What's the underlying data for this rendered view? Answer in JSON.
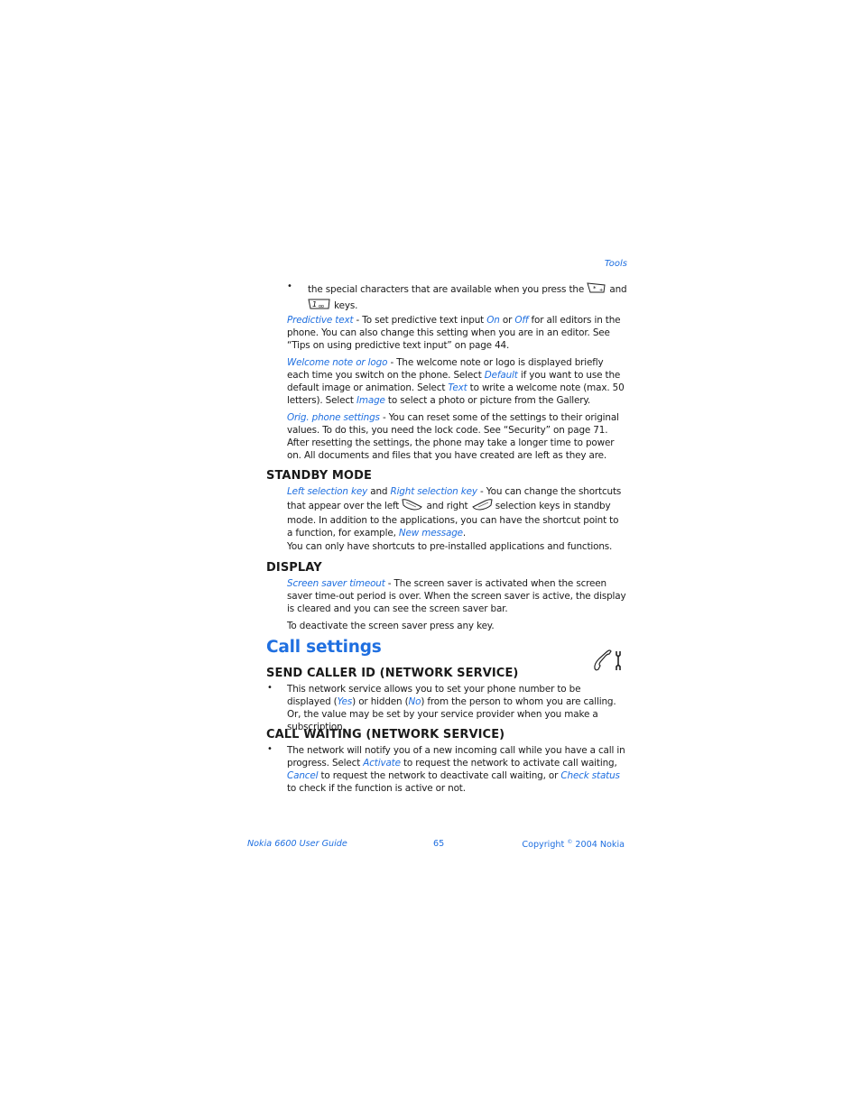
{
  "running_head": "Tools",
  "intro_bullet": {
    "text_before": "the special characters that are available when you press the",
    "and": "and",
    "keys": "keys.",
    "icons": [
      "star-key-icon",
      "one-key-icon"
    ]
  },
  "predictive_text": {
    "term": "Predictive text",
    "t1": " - To set predictive text input ",
    "on": "On",
    "or": " or ",
    "off": "Off",
    "t2": " for all editors in the phone. You can also change this setting when you are in an editor. See “Tips on using predictive text input” on page 44."
  },
  "welcome_note": {
    "term": "Welcome note or logo",
    "t1": " - The welcome note or logo is displayed briefly each time you switch on the phone. Select ",
    "default": "Default",
    "t2": " if you want to use the default image or animation. Select ",
    "text": "Text",
    "t3": " to write a welcome note (max. 50 letters). Select ",
    "image": "Image",
    "t4": " to select a photo or picture from the Gallery."
  },
  "orig_settings": {
    "term": "Orig. phone settings",
    "t1": " - You can reset some of the settings to their original values. To do this, you need the lock code. See “Security” on page 71. After resetting the settings, the phone may take a longer time to power on. All documents and files that you have created are left as they are."
  },
  "standby": {
    "heading": "STANDBY MODE",
    "left_key": "Left selection key",
    "and": " and ",
    "right_key": "Right selection key",
    "t1": " - You can change the shortcuts that appear over the left ",
    "t2": " and right ",
    "t3": " selection keys in standby mode. In addition to the applications, you can have the shortcut point to a function, for example, ",
    "new_message": "New message",
    "t4": ".",
    "note": "You can only have shortcuts to pre-installed applications and functions."
  },
  "display": {
    "heading": "DISPLAY",
    "term": "Screen saver timeout",
    "t1": " - The screen saver is activated when the screen saver time-out period is over. When the screen saver is active, the display is cleared and you can see the screen saver bar.",
    "note": "To deactivate the screen saver press any key."
  },
  "call_settings": {
    "title": "Call settings",
    "icon": "phone-wrench-icon"
  },
  "caller_id": {
    "heading": "SEND CALLER ID (NETWORK SERVICE)",
    "t1": "This network service allows you to set your phone number to be displayed (",
    "yes": "Yes",
    "t2": ") or hidden (",
    "no": "No",
    "t3": ") from the person to whom you are calling. Or, the value may be set by your service provider when you make a subscription."
  },
  "call_waiting": {
    "heading": "CALL WAITING (NETWORK SERVICE)",
    "t1": "The network will notify you of a new incoming call while you have a call in progress. Select ",
    "activate": "Activate",
    "t2": " to request the network to activate call waiting, ",
    "cancel": "Cancel",
    "t3": " to request the network to deactivate call waiting, or ",
    "check_status": "Check status",
    "t4": " to check if the function is active or not."
  },
  "footer": {
    "left": "Nokia 6600 User Guide",
    "page": "65",
    "copyright_prefix": "Copyright ",
    "copyright_symbol": "©",
    "copyright_suffix": " 2004 Nokia"
  }
}
